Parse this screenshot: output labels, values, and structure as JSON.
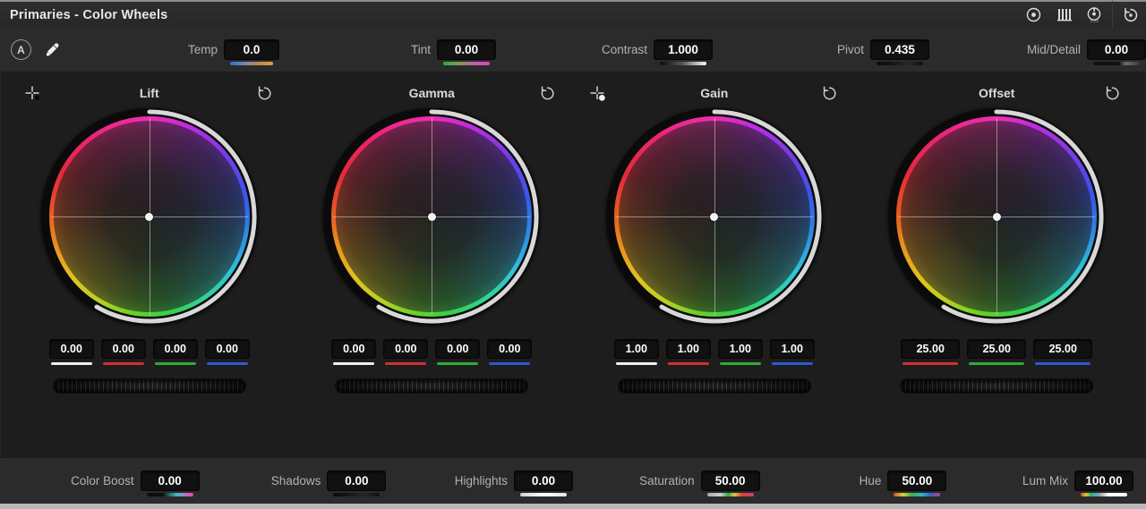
{
  "titlebar": {
    "title": "Primaries - Color Wheels",
    "icons": [
      {
        "name": "primaries-wheels-icon",
        "label": "Primaries Color Wheels"
      },
      {
        "name": "primaries-bars-icon",
        "label": "Primaries Bars"
      },
      {
        "name": "log-wheels-icon",
        "label": "LOG"
      },
      {
        "name": "reset-all-icon",
        "label": "Reset"
      }
    ]
  },
  "toolbar": {
    "auto_balance_label": "A",
    "auto_balance_name": "auto-balance-button",
    "picker_name": "eyedropper-picker-button"
  },
  "top_params": [
    {
      "label": "Temp",
      "value": "0.0",
      "grad": "g-temp",
      "width": "w-temp"
    },
    {
      "label": "Tint",
      "value": "0.00",
      "grad": "g-tint",
      "width": "w-std"
    },
    {
      "label": "Contrast",
      "value": "1.000",
      "grad": "g-contrast",
      "width": "w-std"
    },
    {
      "label": "Pivot",
      "value": "0.435",
      "grad": "g-dark",
      "width": "w-std"
    },
    {
      "label": "Mid/Detail",
      "value": "0.00",
      "grad": "g-middetail",
      "width": "w-std"
    }
  ],
  "wheels": [
    {
      "title": "Lift",
      "picker_icon": "lift-picker-icon",
      "reset_icon": "reset-lift-icon",
      "fields": [
        {
          "value": "0.00",
          "bar": "bar-w",
          "name": "lift-master-field"
        },
        {
          "value": "0.00",
          "bar": "bar-r",
          "name": "lift-red-field"
        },
        {
          "value": "0.00",
          "bar": "bar-g",
          "name": "lift-green-field"
        },
        {
          "value": "0.00",
          "bar": "bar-b",
          "name": "lift-blue-field"
        }
      ]
    },
    {
      "title": "Gamma",
      "picker_icon": null,
      "reset_icon": "reset-gamma-icon",
      "fields": [
        {
          "value": "0.00",
          "bar": "bar-w",
          "name": "gamma-master-field"
        },
        {
          "value": "0.00",
          "bar": "bar-r",
          "name": "gamma-red-field"
        },
        {
          "value": "0.00",
          "bar": "bar-g",
          "name": "gamma-green-field"
        },
        {
          "value": "0.00",
          "bar": "bar-b",
          "name": "gamma-blue-field"
        }
      ]
    },
    {
      "title": "Gain",
      "picker_icon": "gain-picker-icon",
      "reset_icon": "reset-gain-icon",
      "fields": [
        {
          "value": "1.00",
          "bar": "bar-w",
          "name": "gain-master-field"
        },
        {
          "value": "1.00",
          "bar": "bar-r",
          "name": "gain-red-field"
        },
        {
          "value": "1.00",
          "bar": "bar-g",
          "name": "gain-green-field"
        },
        {
          "value": "1.00",
          "bar": "bar-b",
          "name": "gain-blue-field"
        }
      ]
    },
    {
      "title": "Offset",
      "picker_icon": null,
      "reset_icon": "reset-offset-icon",
      "fields": [
        {
          "value": "25.00",
          "bar": "bar-r",
          "name": "offset-red-field",
          "wide": true
        },
        {
          "value": "25.00",
          "bar": "bar-g",
          "name": "offset-green-field",
          "wide": true
        },
        {
          "value": "25.00",
          "bar": "bar-b",
          "name": "offset-blue-field",
          "wide": true
        }
      ]
    }
  ],
  "bottom_params": [
    {
      "label": "Color Boost",
      "value": "0.00",
      "grad": "g-boost",
      "width": "w-std"
    },
    {
      "label": "Shadows",
      "value": "0.00",
      "grad": "g-shadows",
      "width": "w-std"
    },
    {
      "label": "Highlights",
      "value": "0.00",
      "grad": "g-highlights",
      "width": "w-std"
    },
    {
      "label": "Saturation",
      "value": "50.00",
      "grad": "g-sat",
      "width": "w-std"
    },
    {
      "label": "Hue",
      "value": "50.00",
      "grad": "g-hue",
      "width": "w-std"
    },
    {
      "label": "Lum Mix",
      "value": "100.00",
      "grad": "g-lum",
      "width": "w-std"
    }
  ],
  "colors": {
    "panel_bg": "#1d1d1d",
    "bar_bg": "#2b2b2b",
    "title_bg": "#2e2e2e",
    "field_bg": "#111111",
    "text": "#e8e8e8",
    "label": "#b2b2b2",
    "master": "#f0f0f0",
    "red": "#d03030",
    "green": "#2faa3a",
    "blue": "#2f58d0"
  }
}
